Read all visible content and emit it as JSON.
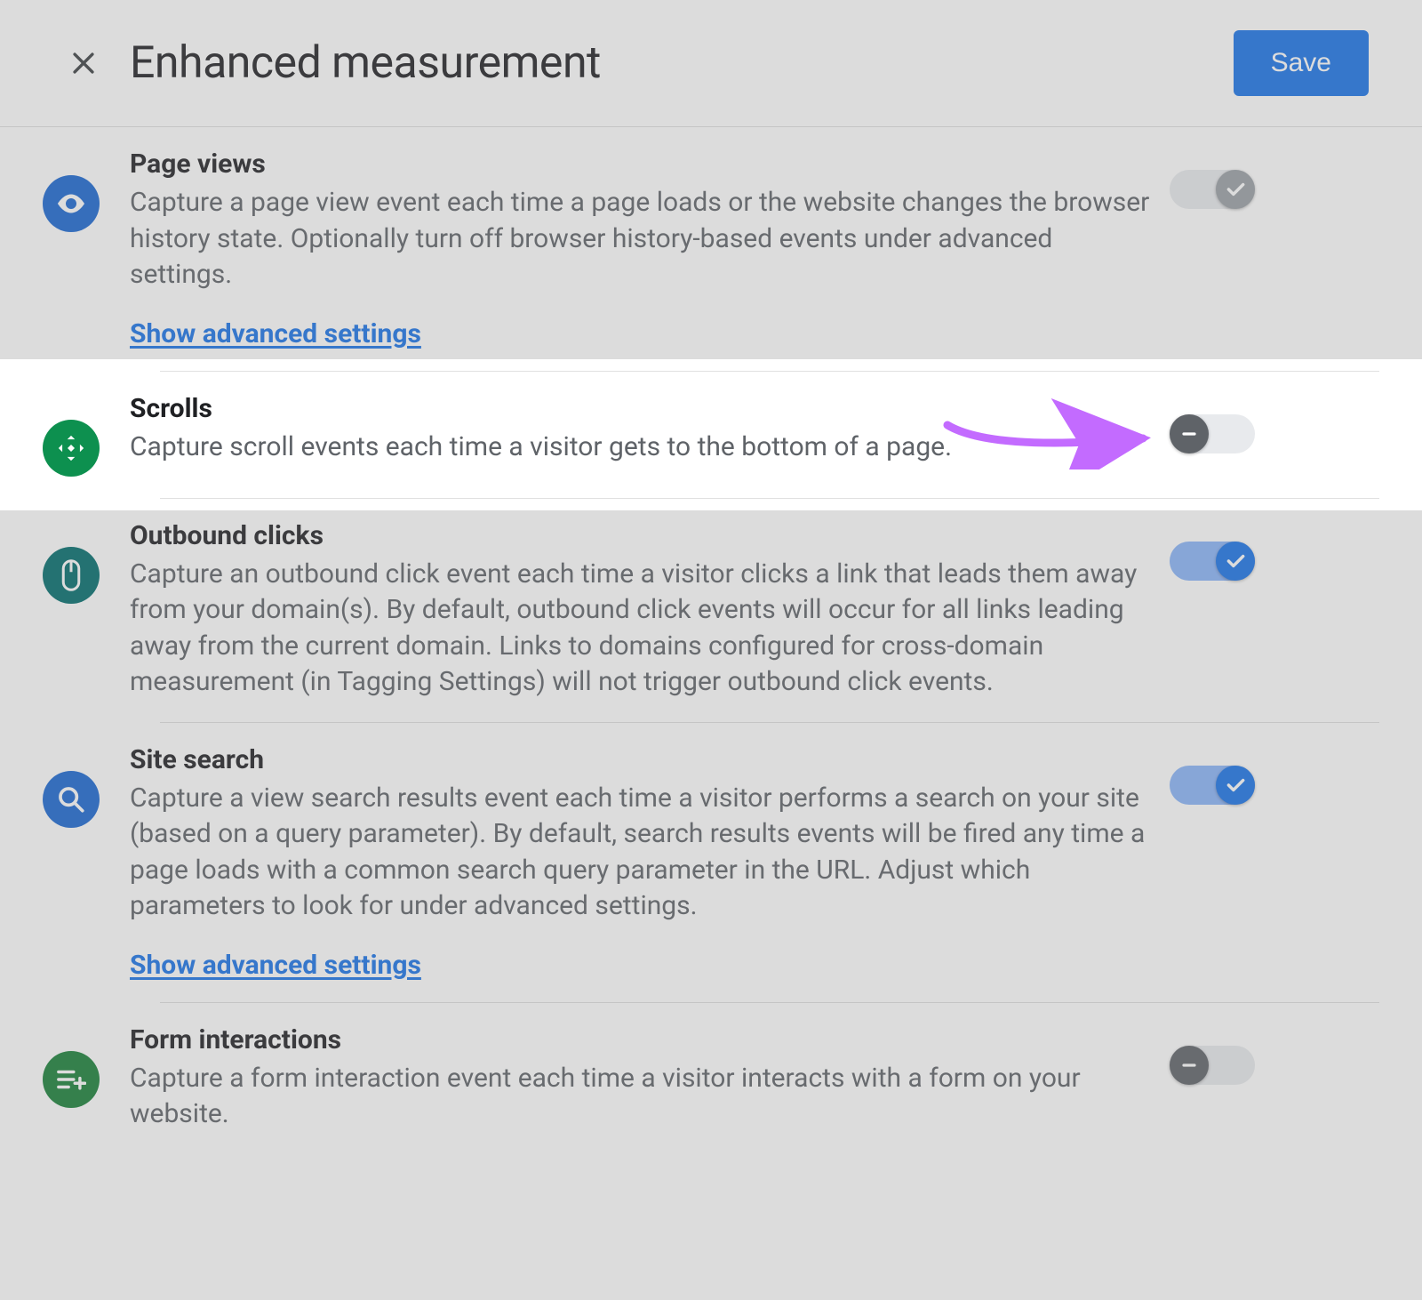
{
  "header": {
    "title": "Enhanced measurement",
    "save_label": "Save"
  },
  "rows": [
    {
      "key": "page_views",
      "icon": "eye-icon",
      "icon_bg": "ic-blue",
      "title": "Page views",
      "desc": "Capture a page view event each time a page loads or the website changes the browser history state. Optionally turn off browser history-based events under advanced settings.",
      "advanced_link": "Show advanced settings",
      "toggle": "locked"
    },
    {
      "key": "scrolls",
      "icon": "scroll-icon",
      "icon_bg": "ic-green",
      "title": "Scrolls",
      "desc": "Capture scroll events each time a visitor gets to the bottom of a page.",
      "toggle": "off",
      "highlighted": true
    },
    {
      "key": "outbound_clicks",
      "icon": "mouse-icon",
      "icon_bg": "ic-teal",
      "title": "Outbound clicks",
      "desc": "Capture an outbound click event each time a visitor clicks a link that leads them away from your domain(s). By default, outbound click events will occur for all links leading away from the current domain. Links to domains configured for cross-domain measurement (in Tagging Settings) will not trigger outbound click events.",
      "toggle": "on"
    },
    {
      "key": "site_search",
      "icon": "search-icon",
      "icon_bg": "ic-blue",
      "title": "Site search",
      "desc": "Capture a view search results event each time a visitor performs a search on your site (based on a query parameter). By default, search results events will be fired any time a page loads with a common search query parameter in the URL. Adjust which parameters to look for under advanced settings.",
      "advanced_link": "Show advanced settings",
      "toggle": "on"
    },
    {
      "key": "form_interactions",
      "icon": "form-icon",
      "icon_bg": "ic-green2",
      "title": "Form interactions",
      "desc": "Capture a form interaction event each time a visitor interacts with a form on your website.",
      "toggle": "off"
    }
  ],
  "annotation": {
    "arrow_color": "#C36BFF"
  }
}
